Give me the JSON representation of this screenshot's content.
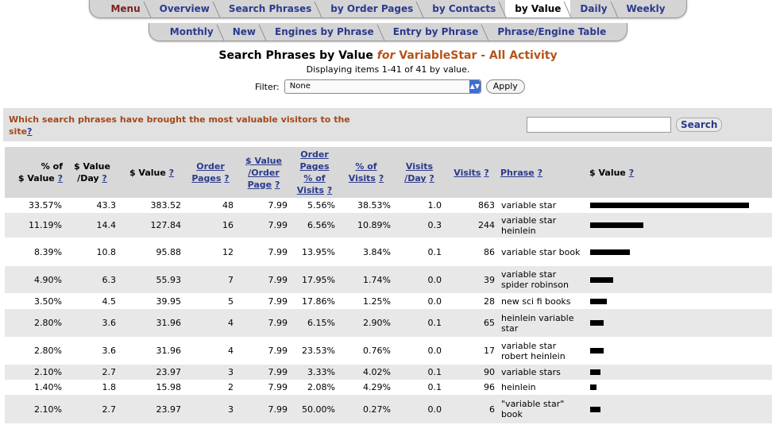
{
  "tabs_row1": [
    "Menu",
    "Overview",
    "Search Phrases",
    "by Order Pages",
    "by Contacts",
    "by Value",
    "Daily",
    "Weekly"
  ],
  "tabs_row1_active": "by Value",
  "tabs_row2": [
    "Monthly",
    "New",
    "Engines by Phrase",
    "Entry by Phrase",
    "Phrase/Engine Table"
  ],
  "title": {
    "main": "Search Phrases by Value",
    "for": "for",
    "app": "VariableStar - All Activity"
  },
  "subtitle": "Displaying items 1-41 of 41 by value.",
  "filter": {
    "label": "Filter:",
    "value": "None",
    "apply": "Apply"
  },
  "question": {
    "text": "Which search phrases have brought the most valuable visitors to the site",
    "help": "?"
  },
  "search": {
    "button": "Search",
    "value": ""
  },
  "headers": [
    {
      "line1": "% of",
      "line2": "$ Value",
      "q": "?"
    },
    {
      "line1": "$ Value",
      "line2": "/Day",
      "q": "?"
    },
    {
      "line1": "$ Value",
      "q": "?"
    },
    {
      "line1": "Order",
      "line2": "Pages",
      "q": "?"
    },
    {
      "line1": "$ Value",
      "line2": "/Order",
      "line3": "Page",
      "q": "?"
    },
    {
      "line1": "Order",
      "line2": "Pages",
      "line3": "% of",
      "line4": "Visits",
      "q": "?"
    },
    {
      "line1": "% of",
      "line2": "Visits",
      "q": "?"
    },
    {
      "line1": "Visits",
      "line2": "/Day",
      "q": "?"
    },
    {
      "line1": "Visits",
      "q": "?"
    },
    {
      "line1": "Phrase",
      "q": "?"
    },
    {
      "line1": "$ Value",
      "q": "?"
    }
  ],
  "rows": [
    {
      "pct_value": "33.57%",
      "value_day": "43.3",
      "value": "383.52",
      "order_pages": "48",
      "value_order": "7.99",
      "order_pct": "5.56%",
      "pct_visits": "38.53%",
      "visits_day": "1.0",
      "visits": "863",
      "phrase": "variable star",
      "bar": 383.52
    },
    {
      "pct_value": "11.19%",
      "value_day": "14.4",
      "value": "127.84",
      "order_pages": "16",
      "value_order": "7.99",
      "order_pct": "6.56%",
      "pct_visits": "10.89%",
      "visits_day": "0.3",
      "visits": "244",
      "phrase": "variable star heinlein",
      "bar": 127.84
    },
    {
      "pct_value": "8.39%",
      "value_day": "10.8",
      "value": "95.88",
      "order_pages": "12",
      "value_order": "7.99",
      "order_pct": "13.95%",
      "pct_visits": "3.84%",
      "visits_day": "0.1",
      "visits": "86",
      "phrase": "variable star book",
      "bar": 95.88
    },
    {
      "pct_value": "4.90%",
      "value_day": "6.3",
      "value": "55.93",
      "order_pages": "7",
      "value_order": "7.99",
      "order_pct": "17.95%",
      "pct_visits": "1.74%",
      "visits_day": "0.0",
      "visits": "39",
      "phrase": "variable star spider robinson",
      "bar": 55.93
    },
    {
      "pct_value": "3.50%",
      "value_day": "4.5",
      "value": "39.95",
      "order_pages": "5",
      "value_order": "7.99",
      "order_pct": "17.86%",
      "pct_visits": "1.25%",
      "visits_day": "0.0",
      "visits": "28",
      "phrase": "new sci fi books",
      "bar": 39.95
    },
    {
      "pct_value": "2.80%",
      "value_day": "3.6",
      "value": "31.96",
      "order_pages": "4",
      "value_order": "7.99",
      "order_pct": "6.15%",
      "pct_visits": "2.90%",
      "visits_day": "0.1",
      "visits": "65",
      "phrase": "heinlein variable star",
      "bar": 31.96
    },
    {
      "pct_value": "2.80%",
      "value_day": "3.6",
      "value": "31.96",
      "order_pages": "4",
      "value_order": "7.99",
      "order_pct": "23.53%",
      "pct_visits": "0.76%",
      "visits_day": "0.0",
      "visits": "17",
      "phrase": "variable star robert heinlein",
      "bar": 31.96
    },
    {
      "pct_value": "2.10%",
      "value_day": "2.7",
      "value": "23.97",
      "order_pages": "3",
      "value_order": "7.99",
      "order_pct": "3.33%",
      "pct_visits": "4.02%",
      "visits_day": "0.1",
      "visits": "90",
      "phrase": "variable stars",
      "bar": 23.97
    },
    {
      "pct_value": "1.40%",
      "value_day": "1.8",
      "value": "15.98",
      "order_pages": "2",
      "value_order": "7.99",
      "order_pct": "2.08%",
      "pct_visits": "4.29%",
      "visits_day": "0.1",
      "visits": "96",
      "phrase": "heinlein",
      "bar": 15.98
    },
    {
      "pct_value": "2.10%",
      "value_day": "2.7",
      "value": "23.97",
      "order_pages": "3",
      "value_order": "7.99",
      "order_pct": "50.00%",
      "pct_visits": "0.27%",
      "visits_day": "0.0",
      "visits": "6",
      "phrase": "\"variable star\" book",
      "bar": 23.97
    }
  ],
  "bar_max": 383.52
}
